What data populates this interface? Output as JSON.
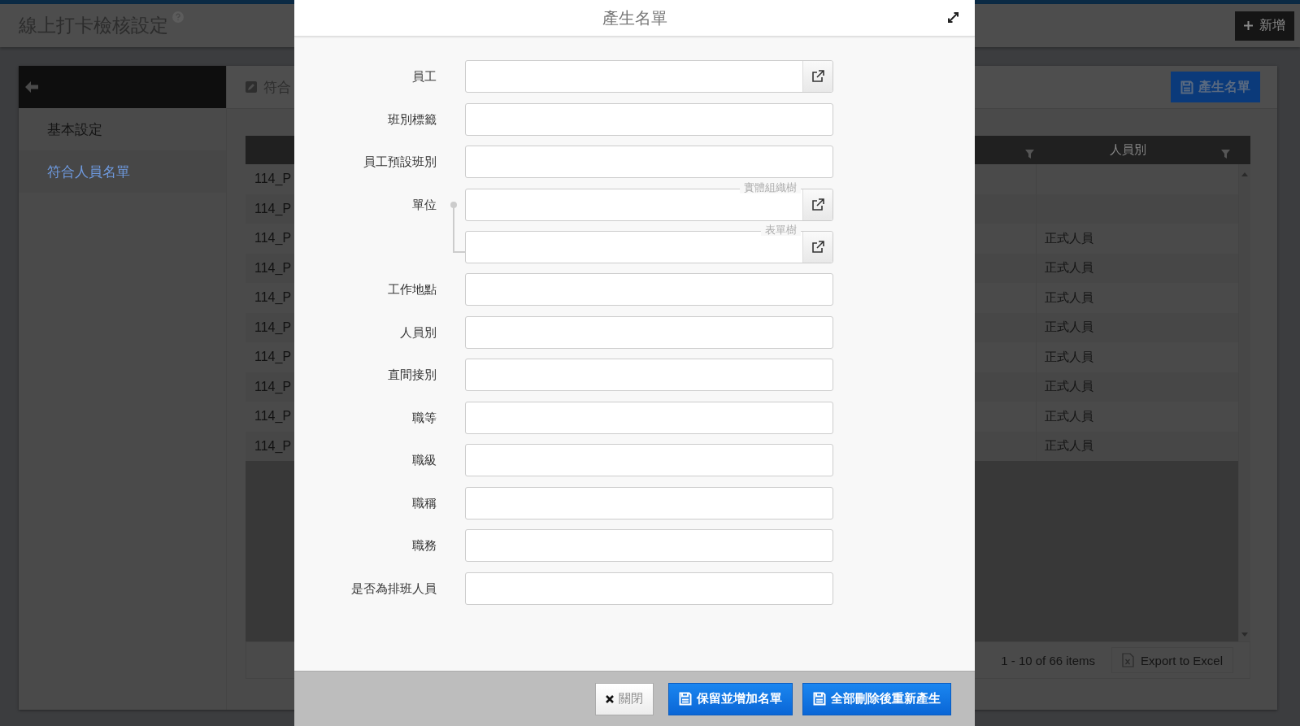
{
  "page": {
    "title": "線上打卡檢核設定",
    "add_button": "新增"
  },
  "sidebar": {
    "items": [
      {
        "label": "基本設定",
        "selected": false
      },
      {
        "label": "符合人員名單",
        "selected": true
      }
    ]
  },
  "toolbar": {
    "tab": "符合",
    "generate_button": "產生名單"
  },
  "grid": {
    "column_label": "人員別",
    "rows": [
      {
        "code": "114_P"
      },
      {
        "code": "114_P"
      },
      {
        "code": "114_P",
        "staff_type": "正式人員"
      },
      {
        "code": "114_P",
        "staff_type": "正式人員"
      },
      {
        "code": "114_P",
        "staff_type": "正式人員"
      },
      {
        "code": "114_P",
        "staff_type": "正式人員"
      },
      {
        "code": "114_P",
        "staff_type": "正式人員"
      },
      {
        "code": "114_P",
        "staff_type": "正式人員"
      },
      {
        "code": "114_P",
        "staff_type": "正式人員"
      },
      {
        "code": "114_P",
        "staff_type": "正式人員"
      }
    ],
    "pager": "1 - 10 of 66 items",
    "export_button": "Export to Excel"
  },
  "dialog": {
    "title": "產生名單",
    "fields": [
      {
        "kind": "lookup",
        "label": "員工"
      },
      {
        "kind": "text",
        "label": "班別標籤"
      },
      {
        "kind": "text",
        "label": "員工預設班別"
      },
      {
        "kind": "tree",
        "label": "單位",
        "parts": [
          {
            "legend": "實體組織樹"
          },
          {
            "legend": "表單樹"
          }
        ]
      },
      {
        "kind": "text",
        "label": "工作地點"
      },
      {
        "kind": "text",
        "label": "人員別"
      },
      {
        "kind": "text",
        "label": "直間接別"
      },
      {
        "kind": "text",
        "label": "職等"
      },
      {
        "kind": "text",
        "label": "職級"
      },
      {
        "kind": "text",
        "label": "職稱"
      },
      {
        "kind": "text",
        "label": "職務"
      },
      {
        "kind": "text",
        "label": "是否為排班人員"
      }
    ],
    "buttons": [
      {
        "kind": "close",
        "label": "關閉"
      },
      {
        "kind": "save",
        "label": "保留並增加名單"
      },
      {
        "kind": "save",
        "label": "全部刪除後重新產生"
      }
    ]
  }
}
